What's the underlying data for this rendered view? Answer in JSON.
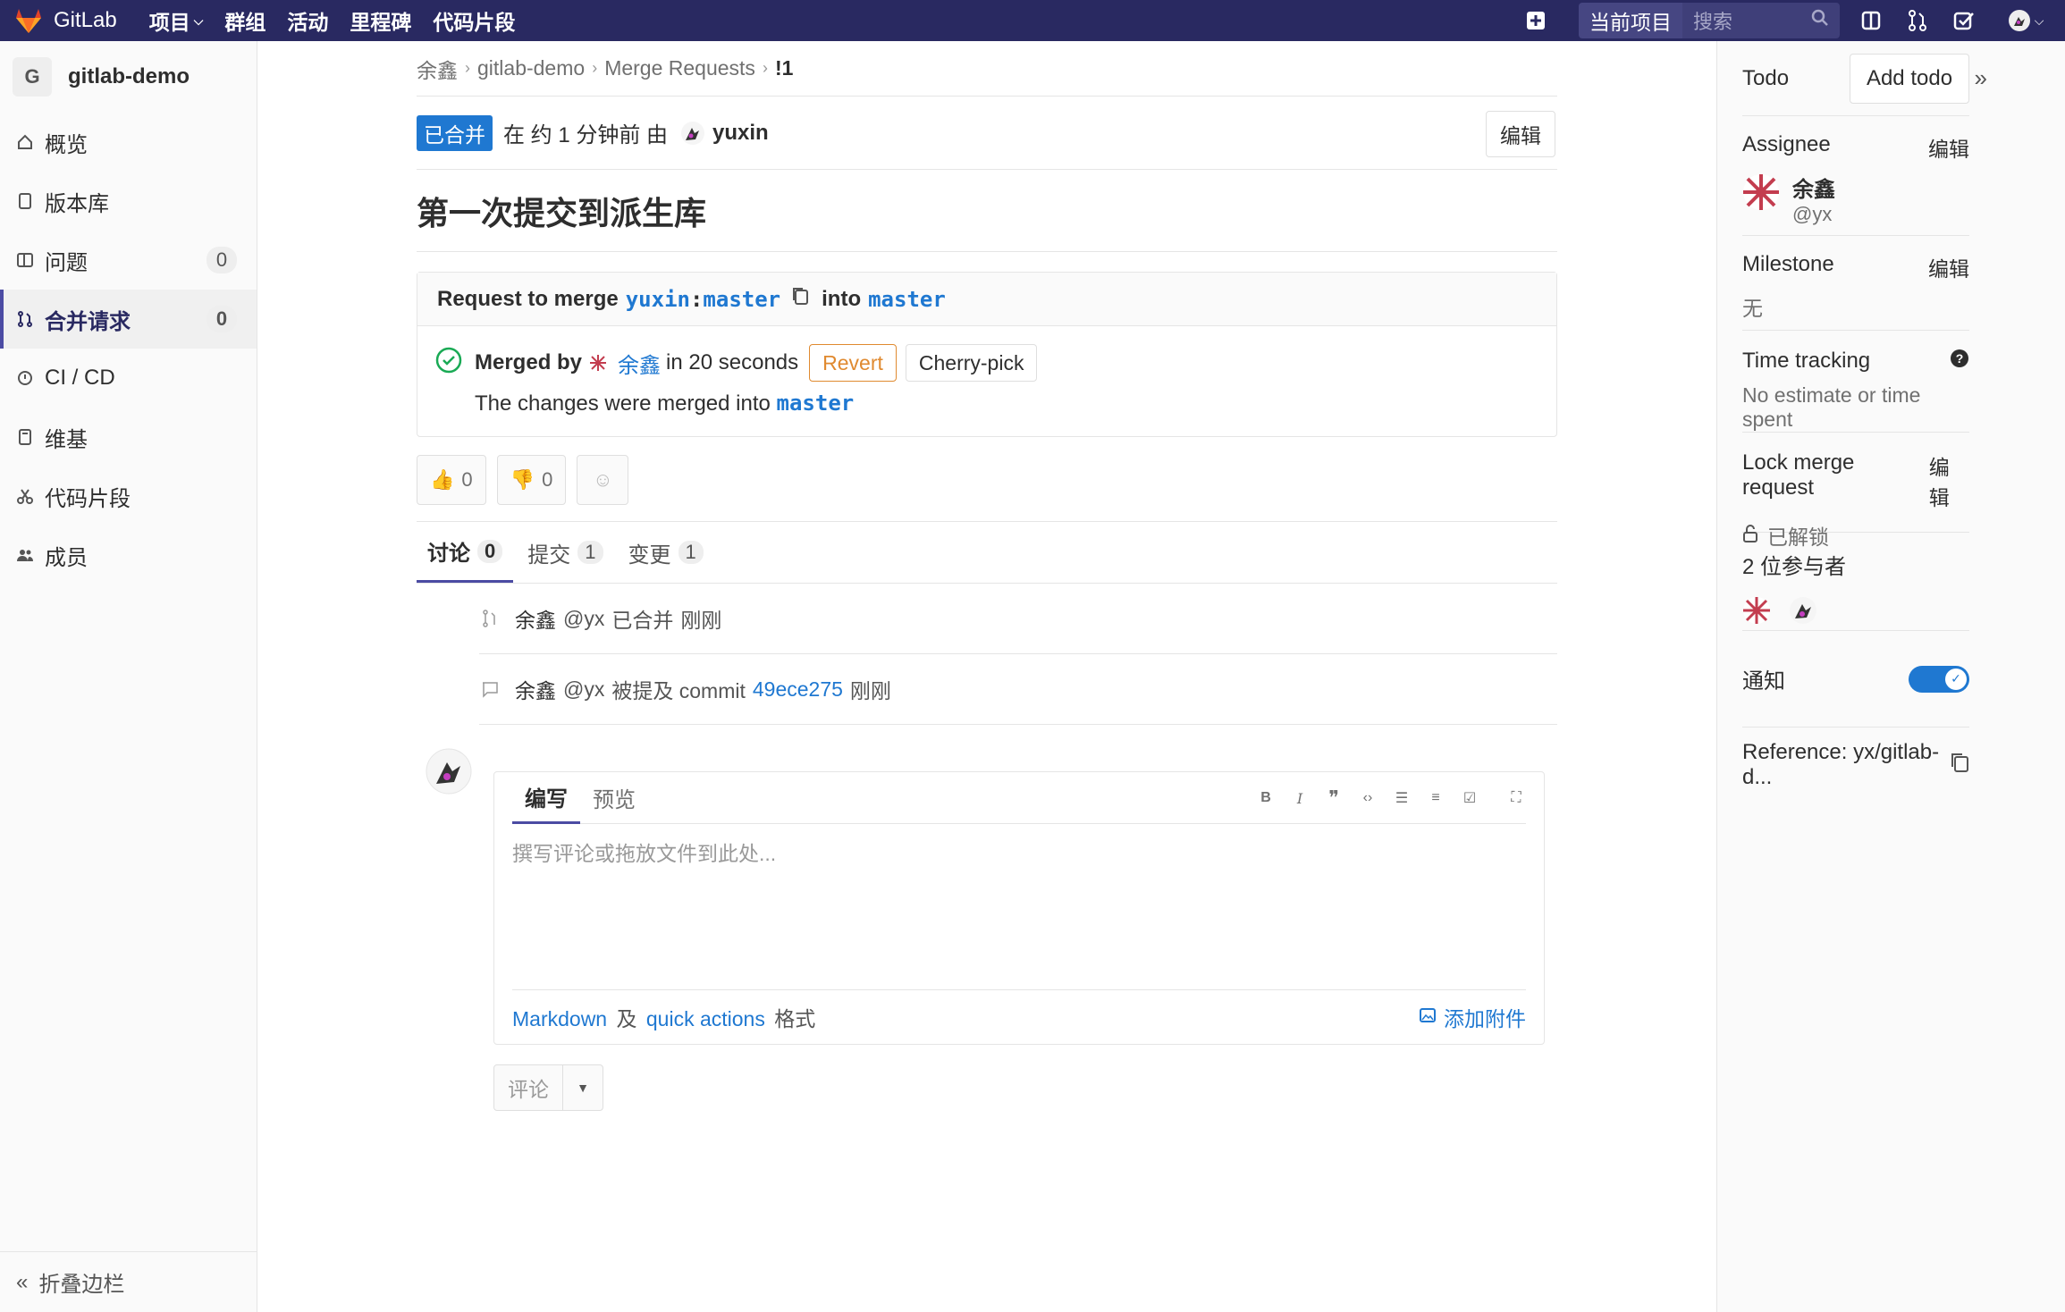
{
  "topnav": {
    "brand": "GitLab",
    "items": [
      "项目",
      "群组",
      "活动",
      "里程碑",
      "代码片段"
    ],
    "scope": "当前项目",
    "search_placeholder": "搜索"
  },
  "sidebar": {
    "project_initial": "G",
    "project_name": "gitlab-demo",
    "items": [
      {
        "label": "概览"
      },
      {
        "label": "版本库"
      },
      {
        "label": "问题",
        "count": "0"
      },
      {
        "label": "合并请求",
        "count": "0"
      },
      {
        "label": "CI / CD"
      },
      {
        "label": "维基"
      },
      {
        "label": "代码片段"
      },
      {
        "label": "成员"
      }
    ],
    "collapse": "折叠边栏"
  },
  "breadcrumb": [
    "余鑫",
    "gitlab-demo",
    "Merge Requests",
    "!1"
  ],
  "mr": {
    "status_badge": "已合并",
    "status_text": "在 约 1 分钟前 由",
    "author": "yuxin",
    "edit": "编辑",
    "title": "第一次提交到派生库",
    "request_prefix": "Request to merge",
    "source_ns": "yuxin",
    "source_branch": "master",
    "into": "into",
    "target_branch": "master",
    "merged_by_label": "Merged by",
    "merged_by_user": "余鑫",
    "merged_in": "in 20 seconds",
    "revert": "Revert",
    "cherry_pick": "Cherry-pick",
    "merged_into_text": "The changes were merged into",
    "merged_into_branch": "master",
    "thumbs_up": "0",
    "thumbs_down": "0"
  },
  "tabs": [
    {
      "label": "讨论",
      "count": "0"
    },
    {
      "label": "提交",
      "count": "1"
    },
    {
      "label": "变更",
      "count": "1"
    }
  ],
  "notes": [
    {
      "user": "余鑫",
      "handle": "@yx",
      "action": "已合并",
      "time": "刚刚"
    },
    {
      "user": "余鑫",
      "handle": "@yx",
      "action": "被提及 commit",
      "commit": "49ece275",
      "time": "刚刚"
    }
  ],
  "editor": {
    "tab_write": "编写",
    "tab_preview": "预览",
    "placeholder": "撰写评论或拖放文件到此处...",
    "markdown": "Markdown",
    "and": "及",
    "quick_actions": "quick actions",
    "format": "格式",
    "attach": "添加附件",
    "submit": "评论"
  },
  "rightbar": {
    "todo": "Todo",
    "add_todo": "Add todo",
    "assignee_label": "Assignee",
    "edit": "编辑",
    "assignee_name": "余鑫",
    "assignee_handle": "@yx",
    "milestone_label": "Milestone",
    "milestone_value": "无",
    "time_label": "Time tracking",
    "time_value": "No estimate or time spent",
    "lock_label": "Lock merge request",
    "lock_value": "已解锁",
    "participants": "2 位参与者",
    "notifications": "通知",
    "reference": "Reference: yx/gitlab-d..."
  },
  "colors": {
    "nav": "#292961",
    "link": "#1f78d1",
    "merged": "#1f78d1",
    "revert": "#e08a30"
  }
}
